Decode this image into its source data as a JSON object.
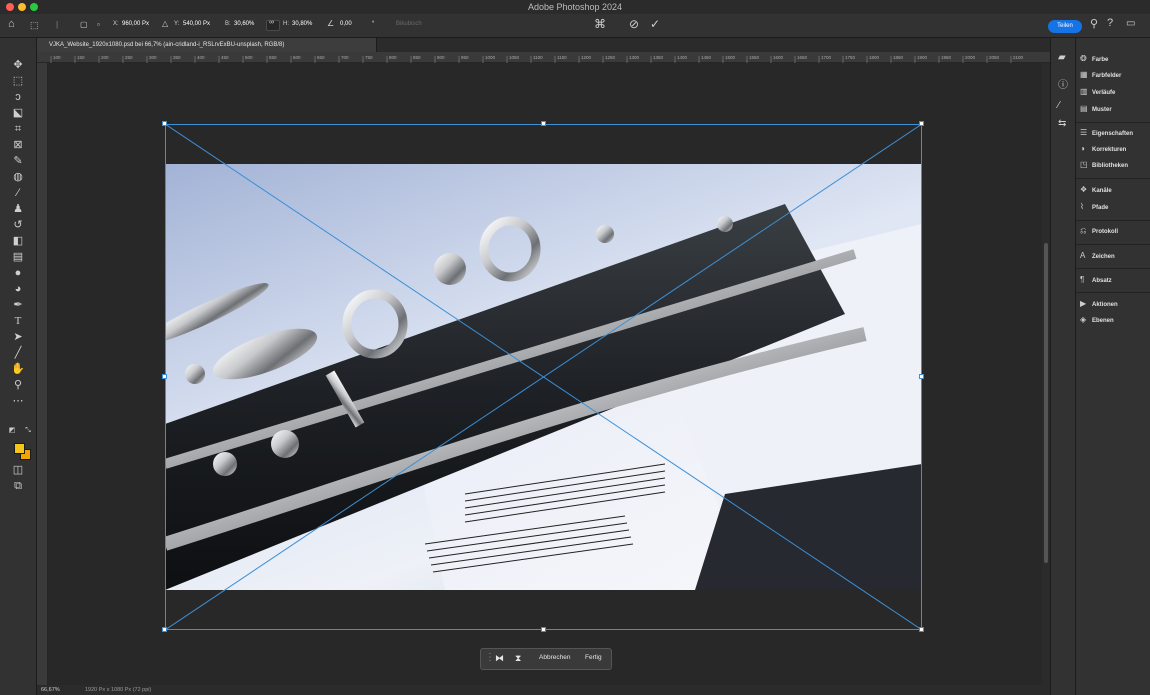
{
  "window": {
    "title": "Adobe Photoshop 2024",
    "traffic_colors": [
      "#ff5f57",
      "#febc2e",
      "#28c840"
    ]
  },
  "options_bar": {
    "x_label": "X:",
    "x_value": "960,00 Px",
    "y_label": "Y:",
    "y_value": "540,00 Px",
    "w_label": "B:",
    "w_value": "30,60%",
    "h_label": "H:",
    "h_value": "30,80%",
    "angle_value": "0,00",
    "interpolation": "Bikubisch",
    "share_label": "Teilen"
  },
  "document": {
    "tab_label": "VJKA_Website_1920x1080.psd bei 66,7% (ain-cridland-i_RSLrvExBU-unsplash, RGB/8)"
  },
  "ruler": {
    "ticks": [
      "100",
      "150",
      "200",
      "250",
      "300",
      "350",
      "400",
      "450",
      "500",
      "550",
      "600",
      "650",
      "700",
      "750",
      "800",
      "850",
      "900",
      "950",
      "1000",
      "1050",
      "1100",
      "1150",
      "1200",
      "1250",
      "1300",
      "1350",
      "1400",
      "1450",
      "1500",
      "1550",
      "1600",
      "1650",
      "1700",
      "1750",
      "1800",
      "1850",
      "1900",
      "1950",
      "2000",
      "2050",
      "2100"
    ]
  },
  "context_bar": {
    "cancel_label": "Abbrechen",
    "done_label": "Fertig"
  },
  "status_bar": {
    "zoom": "66,67%",
    "dimensions": "1920 Px x 1080 Px (72 ppi)"
  },
  "panels": {
    "group1": [
      "Farbe",
      "Farbfelder",
      "Verläufe",
      "Muster"
    ],
    "group2": [
      "Eigenschaften",
      "Korrekturen",
      "Bibliotheken"
    ],
    "group3": [
      "Kanäle",
      "Pfade"
    ],
    "group4": [
      "Protokoll"
    ],
    "group5": [
      "Zeichen"
    ],
    "group6": [
      "Absatz"
    ],
    "group7": [
      "Aktionen",
      "Ebenen"
    ]
  },
  "colors": {
    "foreground": "#f5c518",
    "background": "#f2a400",
    "accent": "#1473e6",
    "transform": "#3d8fd6"
  }
}
